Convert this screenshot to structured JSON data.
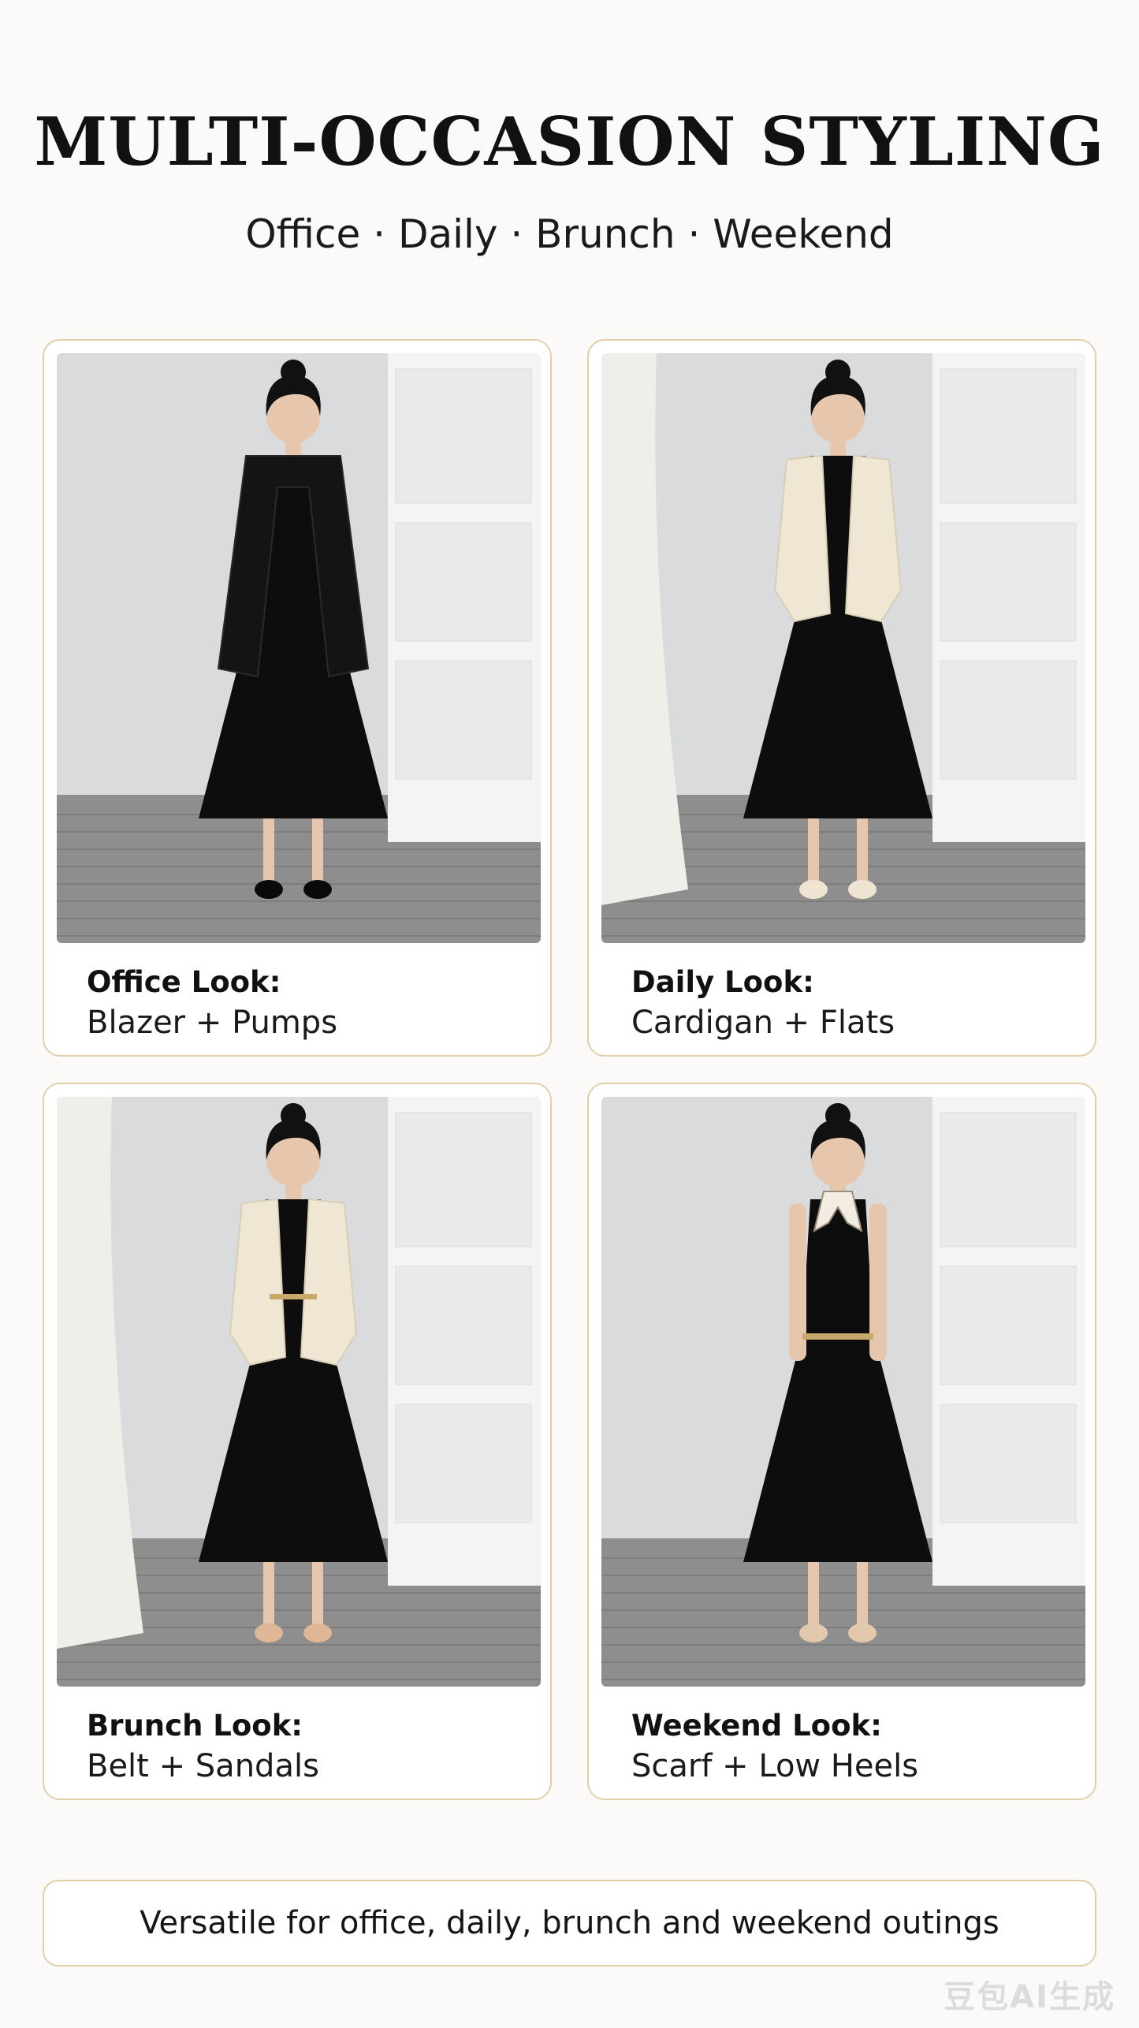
{
  "header": {
    "title": "MULTI-OCCASION STYLING",
    "subtitle": "Office · Daily · Brunch · Weekend"
  },
  "looks": [
    {
      "title": "Office Look:",
      "detail": "Blazer + Pumps",
      "layer": "blazer",
      "shoes": "pumps"
    },
    {
      "title": "Daily Look:",
      "detail": "Cardigan + Flats",
      "layer": "cardigan",
      "shoes": "flats"
    },
    {
      "title": "Brunch Look:",
      "detail": "Belt + Sandals",
      "layer": "cardigan-belt",
      "shoes": "sandals"
    },
    {
      "title": "Weekend Look:",
      "detail": "Scarf + Low Heels",
      "layer": "scarf",
      "shoes": "low-heels"
    }
  ],
  "footer": {
    "text": "Versatile for office, daily, brunch and weekend outings"
  },
  "colors": {
    "accent_border": "#e2cfa6",
    "dress": "#0d0d0d",
    "cream": "#efe6d4",
    "wall": "#d9dbdd",
    "floor": "#8e8e8e"
  }
}
